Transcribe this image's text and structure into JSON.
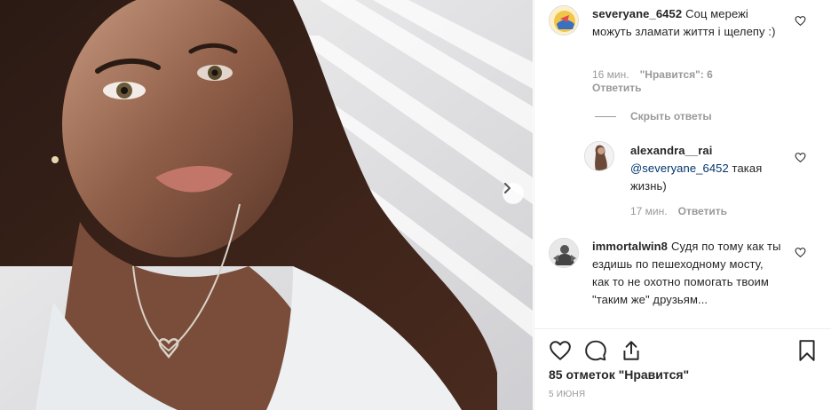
{
  "post": {
    "photo_alt": "selfie photo",
    "likes_text": "85 отметок \"Нравится\"",
    "date": "5 июня"
  },
  "comments": [
    {
      "username": "severyane_6452",
      "text": "Соц мережі можуть зламати життя і щелепу :)",
      "time": "16 мин.",
      "likes": "\"Нравится\": 6",
      "reply_label": "Ответить"
    },
    {
      "username": "alexandra__rai",
      "mention": "@severyane_6452",
      "text": "такая жизнь)",
      "time": "17 мин.",
      "reply_label": "Ответить"
    },
    {
      "username": "immortalwin8",
      "text": "Судя по тому как ты ездишь по пешеходному мосту, как то не охотно помогать твоим \"таким же\" друзьям..."
    }
  ],
  "hide_replies_label": "Скрыть ответы",
  "icons": {
    "like": "heart-icon",
    "comment": "comment-icon",
    "share": "share-icon",
    "save": "bookmark-icon",
    "next": "chevron-right-icon"
  },
  "colors": {
    "text": "#262626",
    "muted": "#999999",
    "mention": "#003569",
    "border": "#efefef"
  }
}
